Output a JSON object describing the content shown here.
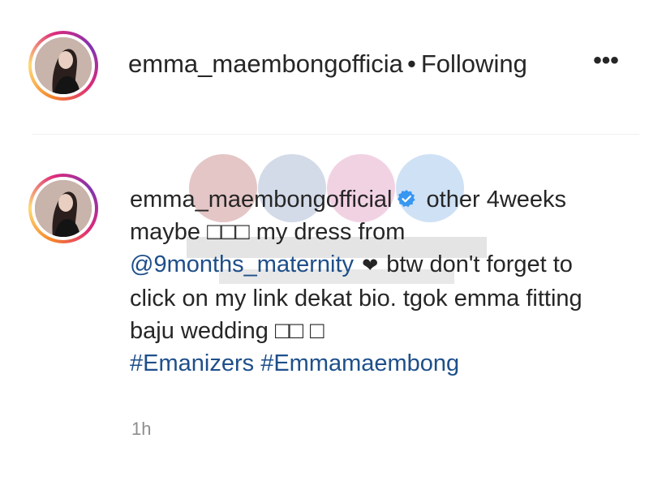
{
  "header": {
    "username": "emma_maembongofficial",
    "separator": "•",
    "follow_status": "Following",
    "more_label": "•••"
  },
  "comment": {
    "author": "emma_maembongofficial",
    "text_part1": "other 4weeks maybe □□□ my dress from",
    "mention": "@9months_maternity",
    "heart": "❤",
    "text_part2": "btw don't forget to click on my link dekat bio. tgok emma fitting baju wedding □□ □",
    "hashtags": [
      "#Emanizers",
      "#Emmamaembong"
    ],
    "timestamp": "1h"
  },
  "icons": {
    "verified": "verified-badge-icon",
    "more": "more-options-icon",
    "heart": "heart-icon"
  },
  "colors": {
    "link": "#1e4f8a",
    "verified": "#3897f0",
    "text": "#262626",
    "muted": "#8e8e8e"
  }
}
